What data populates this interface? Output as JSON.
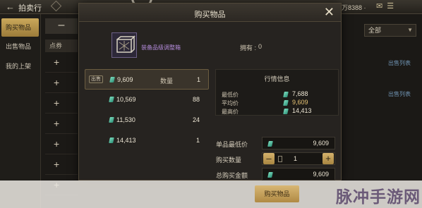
{
  "topbar": {
    "title": "拍卖行",
    "currency": "万8388 ·"
  },
  "sidebar": {
    "items": [
      "购买物品",
      "出售物品",
      "我的上架"
    ]
  },
  "list": {
    "header": "点券"
  },
  "filter": {
    "selected": "全部"
  },
  "right_links": [
    "出售列表",
    "出售列表"
  ],
  "dialog": {
    "title": "购买物品",
    "item_name": "装备品级调整箱",
    "own_label": "拥有 :",
    "own_value": "0",
    "listings": [
      {
        "badge": "出售",
        "price": "9,609",
        "qty_label": "数量",
        "qty": "1"
      },
      {
        "price": "10,569",
        "qty": "88"
      },
      {
        "price": "11,530",
        "qty": "24"
      },
      {
        "price": "14,413",
        "qty": "1"
      }
    ],
    "market": {
      "title": "行情信息",
      "rows": [
        {
          "label": "最低价",
          "value": "7,688"
        },
        {
          "label": "平均价",
          "value": "9,609"
        },
        {
          "label": "最高价",
          "value": "14,413"
        }
      ]
    },
    "unit_price_label": "单品最低价",
    "unit_price": "9,609",
    "qty_label": "购买数量",
    "qty_value": "1",
    "total_label": "总购买金额",
    "total": "9,609",
    "confirm": "购买物品"
  },
  "watermark": "脉冲手游网"
}
